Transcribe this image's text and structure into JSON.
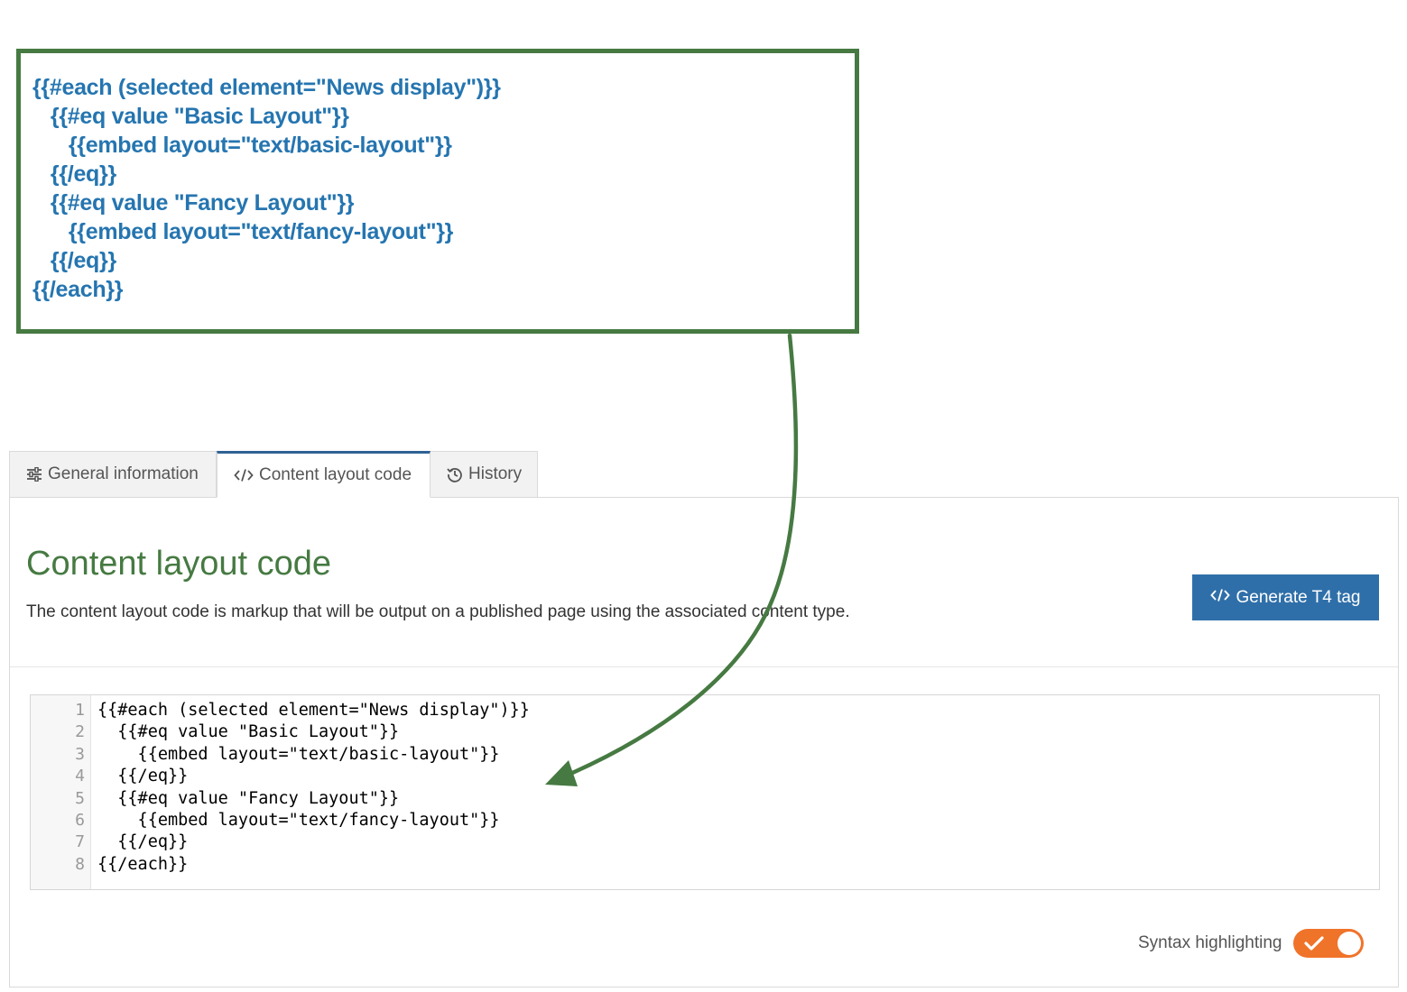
{
  "annotation": {
    "lines": [
      "{{#each (selected element=\"News display\")}}",
      "   {{#eq value \"Basic Layout\"}}",
      "      {{embed layout=\"text/basic-layout\"}}",
      "   {{/eq}}",
      "   {{#eq value \"Fancy Layout\"}}",
      "      {{embed layout=\"text/fancy-layout\"}}",
      "   {{/eq}}",
      "{{/each}}"
    ]
  },
  "tabs": [
    {
      "label": "General information",
      "icon": "sliders-icon"
    },
    {
      "label": "Content layout code",
      "icon": "code-icon",
      "active": true
    },
    {
      "label": "History",
      "icon": "history-icon"
    }
  ],
  "panel": {
    "title": "Content layout code",
    "description": "The content layout code is markup that will be output on a published page using the associated content type.",
    "generate_button": "Generate T4 tag"
  },
  "editor": {
    "line_numbers": [
      "1",
      "2",
      "3",
      "4",
      "5",
      "6",
      "7",
      "8"
    ],
    "lines": [
      "{{#each (selected element=\"News display\")}}",
      "  {{#eq value \"Basic Layout\"}}",
      "    {{embed layout=\"text/basic-layout\"}}",
      "  {{/eq}}",
      "  {{#eq value \"Fancy Layout\"}}",
      "    {{embed layout=\"text/fancy-layout\"}}",
      "  {{/eq}}",
      "{{/each}}"
    ]
  },
  "syntax": {
    "label": "Syntax highlighting",
    "enabled": true
  },
  "colors": {
    "annotation_border": "#467a42",
    "annotation_text": "#2575b0",
    "title_green": "#467a42",
    "button_blue": "#2f6fa9",
    "toggle_orange": "#f0732a"
  }
}
